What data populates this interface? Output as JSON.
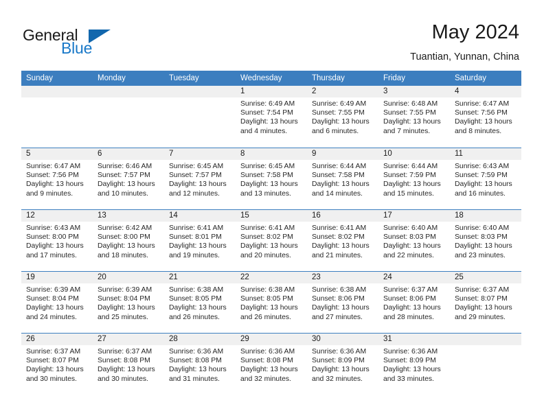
{
  "brand": {
    "name_part1": "General",
    "name_part2": "Blue",
    "logo_icon": "triangle-logo-icon",
    "accent_color": "#1267ad"
  },
  "header": {
    "title": "May 2024",
    "subtitle": "Tuantian, Yunnan, China"
  },
  "theme": {
    "header_row_color": "#3c7ebf",
    "day_band_color": "#f0f0f0"
  },
  "weekdays": [
    "Sunday",
    "Monday",
    "Tuesday",
    "Wednesday",
    "Thursday",
    "Friday",
    "Saturday"
  ],
  "weeks": [
    [
      {
        "day": "",
        "empty": true,
        "sunrise": "",
        "sunset": "",
        "daylight_l1": "",
        "daylight_l2": ""
      },
      {
        "day": "",
        "empty": true,
        "sunrise": "",
        "sunset": "",
        "daylight_l1": "",
        "daylight_l2": ""
      },
      {
        "day": "",
        "empty": true,
        "sunrise": "",
        "sunset": "",
        "daylight_l1": "",
        "daylight_l2": ""
      },
      {
        "day": "1",
        "sunrise": "Sunrise: 6:49 AM",
        "sunset": "Sunset: 7:54 PM",
        "daylight_l1": "Daylight: 13 hours",
        "daylight_l2": "and 4 minutes."
      },
      {
        "day": "2",
        "sunrise": "Sunrise: 6:49 AM",
        "sunset": "Sunset: 7:55 PM",
        "daylight_l1": "Daylight: 13 hours",
        "daylight_l2": "and 6 minutes."
      },
      {
        "day": "3",
        "sunrise": "Sunrise: 6:48 AM",
        "sunset": "Sunset: 7:55 PM",
        "daylight_l1": "Daylight: 13 hours",
        "daylight_l2": "and 7 minutes."
      },
      {
        "day": "4",
        "sunrise": "Sunrise: 6:47 AM",
        "sunset": "Sunset: 7:56 PM",
        "daylight_l1": "Daylight: 13 hours",
        "daylight_l2": "and 8 minutes."
      }
    ],
    [
      {
        "day": "5",
        "sunrise": "Sunrise: 6:47 AM",
        "sunset": "Sunset: 7:56 PM",
        "daylight_l1": "Daylight: 13 hours",
        "daylight_l2": "and 9 minutes."
      },
      {
        "day": "6",
        "sunrise": "Sunrise: 6:46 AM",
        "sunset": "Sunset: 7:57 PM",
        "daylight_l1": "Daylight: 13 hours",
        "daylight_l2": "and 10 minutes."
      },
      {
        "day": "7",
        "sunrise": "Sunrise: 6:45 AM",
        "sunset": "Sunset: 7:57 PM",
        "daylight_l1": "Daylight: 13 hours",
        "daylight_l2": "and 12 minutes."
      },
      {
        "day": "8",
        "sunrise": "Sunrise: 6:45 AM",
        "sunset": "Sunset: 7:58 PM",
        "daylight_l1": "Daylight: 13 hours",
        "daylight_l2": "and 13 minutes."
      },
      {
        "day": "9",
        "sunrise": "Sunrise: 6:44 AM",
        "sunset": "Sunset: 7:58 PM",
        "daylight_l1": "Daylight: 13 hours",
        "daylight_l2": "and 14 minutes."
      },
      {
        "day": "10",
        "sunrise": "Sunrise: 6:44 AM",
        "sunset": "Sunset: 7:59 PM",
        "daylight_l1": "Daylight: 13 hours",
        "daylight_l2": "and 15 minutes."
      },
      {
        "day": "11",
        "sunrise": "Sunrise: 6:43 AM",
        "sunset": "Sunset: 7:59 PM",
        "daylight_l1": "Daylight: 13 hours",
        "daylight_l2": "and 16 minutes."
      }
    ],
    [
      {
        "day": "12",
        "sunrise": "Sunrise: 6:43 AM",
        "sunset": "Sunset: 8:00 PM",
        "daylight_l1": "Daylight: 13 hours",
        "daylight_l2": "and 17 minutes."
      },
      {
        "day": "13",
        "sunrise": "Sunrise: 6:42 AM",
        "sunset": "Sunset: 8:00 PM",
        "daylight_l1": "Daylight: 13 hours",
        "daylight_l2": "and 18 minutes."
      },
      {
        "day": "14",
        "sunrise": "Sunrise: 6:41 AM",
        "sunset": "Sunset: 8:01 PM",
        "daylight_l1": "Daylight: 13 hours",
        "daylight_l2": "and 19 minutes."
      },
      {
        "day": "15",
        "sunrise": "Sunrise: 6:41 AM",
        "sunset": "Sunset: 8:02 PM",
        "daylight_l1": "Daylight: 13 hours",
        "daylight_l2": "and 20 minutes."
      },
      {
        "day": "16",
        "sunrise": "Sunrise: 6:41 AM",
        "sunset": "Sunset: 8:02 PM",
        "daylight_l1": "Daylight: 13 hours",
        "daylight_l2": "and 21 minutes."
      },
      {
        "day": "17",
        "sunrise": "Sunrise: 6:40 AM",
        "sunset": "Sunset: 8:03 PM",
        "daylight_l1": "Daylight: 13 hours",
        "daylight_l2": "and 22 minutes."
      },
      {
        "day": "18",
        "sunrise": "Sunrise: 6:40 AM",
        "sunset": "Sunset: 8:03 PM",
        "daylight_l1": "Daylight: 13 hours",
        "daylight_l2": "and 23 minutes."
      }
    ],
    [
      {
        "day": "19",
        "sunrise": "Sunrise: 6:39 AM",
        "sunset": "Sunset: 8:04 PM",
        "daylight_l1": "Daylight: 13 hours",
        "daylight_l2": "and 24 minutes."
      },
      {
        "day": "20",
        "sunrise": "Sunrise: 6:39 AM",
        "sunset": "Sunset: 8:04 PM",
        "daylight_l1": "Daylight: 13 hours",
        "daylight_l2": "and 25 minutes."
      },
      {
        "day": "21",
        "sunrise": "Sunrise: 6:38 AM",
        "sunset": "Sunset: 8:05 PM",
        "daylight_l1": "Daylight: 13 hours",
        "daylight_l2": "and 26 minutes."
      },
      {
        "day": "22",
        "sunrise": "Sunrise: 6:38 AM",
        "sunset": "Sunset: 8:05 PM",
        "daylight_l1": "Daylight: 13 hours",
        "daylight_l2": "and 26 minutes."
      },
      {
        "day": "23",
        "sunrise": "Sunrise: 6:38 AM",
        "sunset": "Sunset: 8:06 PM",
        "daylight_l1": "Daylight: 13 hours",
        "daylight_l2": "and 27 minutes."
      },
      {
        "day": "24",
        "sunrise": "Sunrise: 6:37 AM",
        "sunset": "Sunset: 8:06 PM",
        "daylight_l1": "Daylight: 13 hours",
        "daylight_l2": "and 28 minutes."
      },
      {
        "day": "25",
        "sunrise": "Sunrise: 6:37 AM",
        "sunset": "Sunset: 8:07 PM",
        "daylight_l1": "Daylight: 13 hours",
        "daylight_l2": "and 29 minutes."
      }
    ],
    [
      {
        "day": "26",
        "sunrise": "Sunrise: 6:37 AM",
        "sunset": "Sunset: 8:07 PM",
        "daylight_l1": "Daylight: 13 hours",
        "daylight_l2": "and 30 minutes."
      },
      {
        "day": "27",
        "sunrise": "Sunrise: 6:37 AM",
        "sunset": "Sunset: 8:08 PM",
        "daylight_l1": "Daylight: 13 hours",
        "daylight_l2": "and 30 minutes."
      },
      {
        "day": "28",
        "sunrise": "Sunrise: 6:36 AM",
        "sunset": "Sunset: 8:08 PM",
        "daylight_l1": "Daylight: 13 hours",
        "daylight_l2": "and 31 minutes."
      },
      {
        "day": "29",
        "sunrise": "Sunrise: 6:36 AM",
        "sunset": "Sunset: 8:08 PM",
        "daylight_l1": "Daylight: 13 hours",
        "daylight_l2": "and 32 minutes."
      },
      {
        "day": "30",
        "sunrise": "Sunrise: 6:36 AM",
        "sunset": "Sunset: 8:09 PM",
        "daylight_l1": "Daylight: 13 hours",
        "daylight_l2": "and 32 minutes."
      },
      {
        "day": "31",
        "sunrise": "Sunrise: 6:36 AM",
        "sunset": "Sunset: 8:09 PM",
        "daylight_l1": "Daylight: 13 hours",
        "daylight_l2": "and 33 minutes."
      },
      {
        "day": "",
        "empty": true,
        "sunrise": "",
        "sunset": "",
        "daylight_l1": "",
        "daylight_l2": ""
      }
    ]
  ]
}
